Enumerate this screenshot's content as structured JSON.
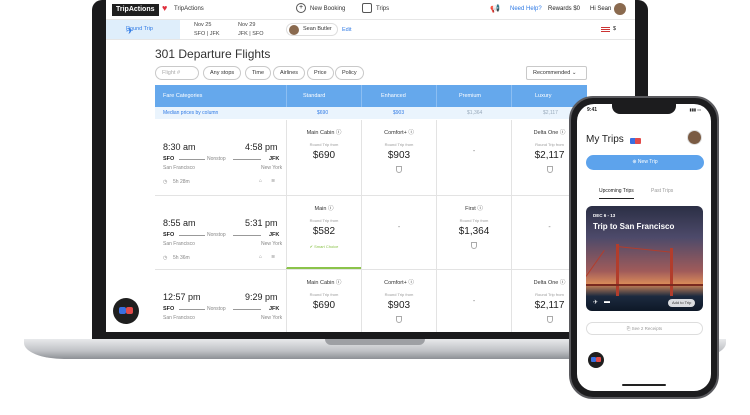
{
  "colors": {
    "accent": "#2f7ae5",
    "header_blue": "#65a8ec",
    "selected_green": "#8bc34a",
    "brand_red": "#e24a4a",
    "brand_blue": "#3a6fe0"
  },
  "nav": {
    "logo": "TripActions",
    "company": "TripActions",
    "new_booking": "New Booking",
    "trips": "Trips",
    "help": "Need Help?",
    "rewards": "Rewards $0",
    "greeting": "Hi Sean"
  },
  "search": {
    "mode": "Round Trip",
    "outbound_date": "Nov 25",
    "outbound_route": "SFO | JFK",
    "return_date": "Nov 29",
    "return_route": "JFK | SFO",
    "traveler": "Sean Butler",
    "edit": "Edit",
    "currency": "$"
  },
  "results": {
    "title": "301 Departure Flights",
    "filters": {
      "search_placeholder": "Flight #",
      "stops": "Any stops",
      "time": "Time",
      "airlines": "Airlines",
      "price": "Price",
      "policy": "Policy"
    },
    "sort": "Recommended",
    "fare_categories_label": "Fare Categories",
    "columns": [
      "Standard",
      "Enhanced",
      "Premium",
      "Luxury"
    ],
    "median_label": "Median prices by column",
    "median_prices": [
      "$690",
      "$903",
      "$1,364",
      "$2,117"
    ],
    "round_trip_from": "Round Trip from",
    "nonstop": "Nonstop",
    "flights": [
      {
        "depart": "8:30 am",
        "arrive": "4:58 pm",
        "from_code": "SFO",
        "to_code": "JFK",
        "from_city": "San Francisco",
        "to_city": "New York",
        "duration": "5h 28m",
        "fares": [
          {
            "cabin": "Main Cabin",
            "price": "$690"
          },
          {
            "cabin": "Comfort+",
            "price": "$903"
          },
          {
            "cabin": "",
            "price": ""
          },
          {
            "cabin": "Delta One",
            "price": "$2,117"
          }
        ]
      },
      {
        "depart": "8:55 am",
        "arrive": "5:31 pm",
        "from_code": "SFO",
        "to_code": "JFK",
        "from_city": "San Francisco",
        "to_city": "New York",
        "duration": "5h 36m",
        "smart_choice": "Smart Choice",
        "fares": [
          {
            "cabin": "Main",
            "price": "$582"
          },
          {
            "cabin": "",
            "price": ""
          },
          {
            "cabin": "First",
            "price": "$1,364"
          },
          {
            "cabin": "",
            "price": ""
          }
        ]
      },
      {
        "depart": "12:57 pm",
        "arrive": "9:29 pm",
        "from_code": "SFO",
        "to_code": "JFK",
        "from_city": "San Francisco",
        "to_city": "New York",
        "duration": "",
        "fares": [
          {
            "cabin": "Main Cabin",
            "price": "$690"
          },
          {
            "cabin": "Comfort+",
            "price": "$903"
          },
          {
            "cabin": "",
            "price": ""
          },
          {
            "cabin": "Delta One",
            "price": "$2,117"
          }
        ]
      }
    ]
  },
  "phone": {
    "time": "9:41",
    "title": "My Trips",
    "new_trip": "New Trip",
    "tab_upcoming": "Upcoming Trips",
    "tab_past": "Past Trips",
    "trip_dates": "DEC 6 - 13",
    "trip_title": "Trip to San Francisco",
    "add_to_trip": "Add to Trip",
    "receipts": "See 2 Receipts"
  }
}
